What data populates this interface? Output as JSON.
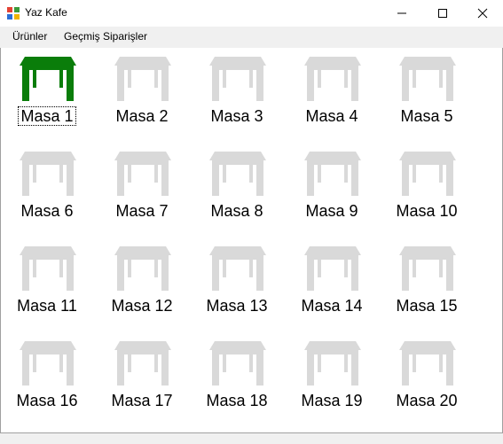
{
  "window": {
    "title": "Yaz Kafe",
    "app_icon": "windows-form-icon"
  },
  "menu": {
    "items": [
      {
        "label": "Ürünler"
      },
      {
        "label": "Geçmiş Siparişler"
      }
    ]
  },
  "colors": {
    "occupied": "#0a7d0a",
    "empty": "#d9d9d9"
  },
  "tables": [
    {
      "label": "Masa 1",
      "status": "occupied"
    },
    {
      "label": "Masa 2",
      "status": "empty"
    },
    {
      "label": "Masa 3",
      "status": "empty"
    },
    {
      "label": "Masa 4",
      "status": "empty"
    },
    {
      "label": "Masa 5",
      "status": "empty"
    },
    {
      "label": "Masa 6",
      "status": "empty"
    },
    {
      "label": "Masa 7",
      "status": "empty"
    },
    {
      "label": "Masa 8",
      "status": "empty"
    },
    {
      "label": "Masa 9",
      "status": "empty"
    },
    {
      "label": "Masa 10",
      "status": "empty"
    },
    {
      "label": "Masa 11",
      "status": "empty"
    },
    {
      "label": "Masa 12",
      "status": "empty"
    },
    {
      "label": "Masa 13",
      "status": "empty"
    },
    {
      "label": "Masa 14",
      "status": "empty"
    },
    {
      "label": "Masa 15",
      "status": "empty"
    },
    {
      "label": "Masa 16",
      "status": "empty"
    },
    {
      "label": "Masa 17",
      "status": "empty"
    },
    {
      "label": "Masa 18",
      "status": "empty"
    },
    {
      "label": "Masa 19",
      "status": "empty"
    },
    {
      "label": "Masa 20",
      "status": "empty"
    }
  ]
}
